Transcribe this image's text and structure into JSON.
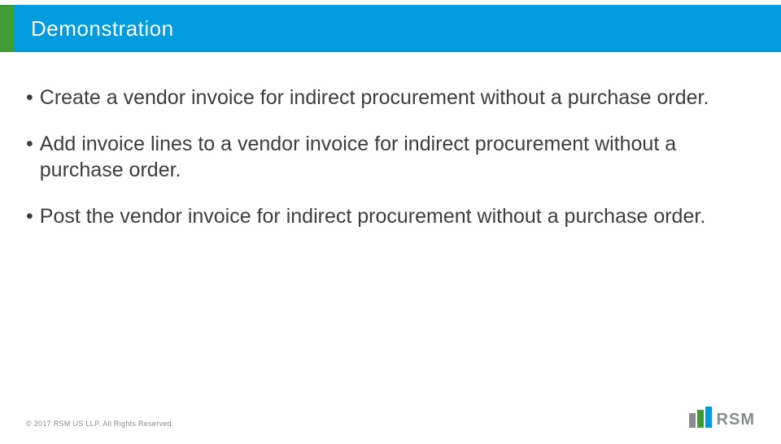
{
  "header": {
    "title": "Demonstration"
  },
  "bullets": [
    "Create a vendor invoice for indirect procurement without a purchase order.",
    "Add invoice lines to a vendor invoice for indirect procurement without a purchase order.",
    "Post the vendor invoice for indirect procurement without a purchase order."
  ],
  "footer": {
    "copyright": "© 2017 RSM US LLP. All Rights Reserved."
  },
  "logo": {
    "text": "RSM"
  },
  "colors": {
    "accent_green": "#3f9c35",
    "brand_blue": "#009cde",
    "logo_grey": "#8a8d8f"
  }
}
